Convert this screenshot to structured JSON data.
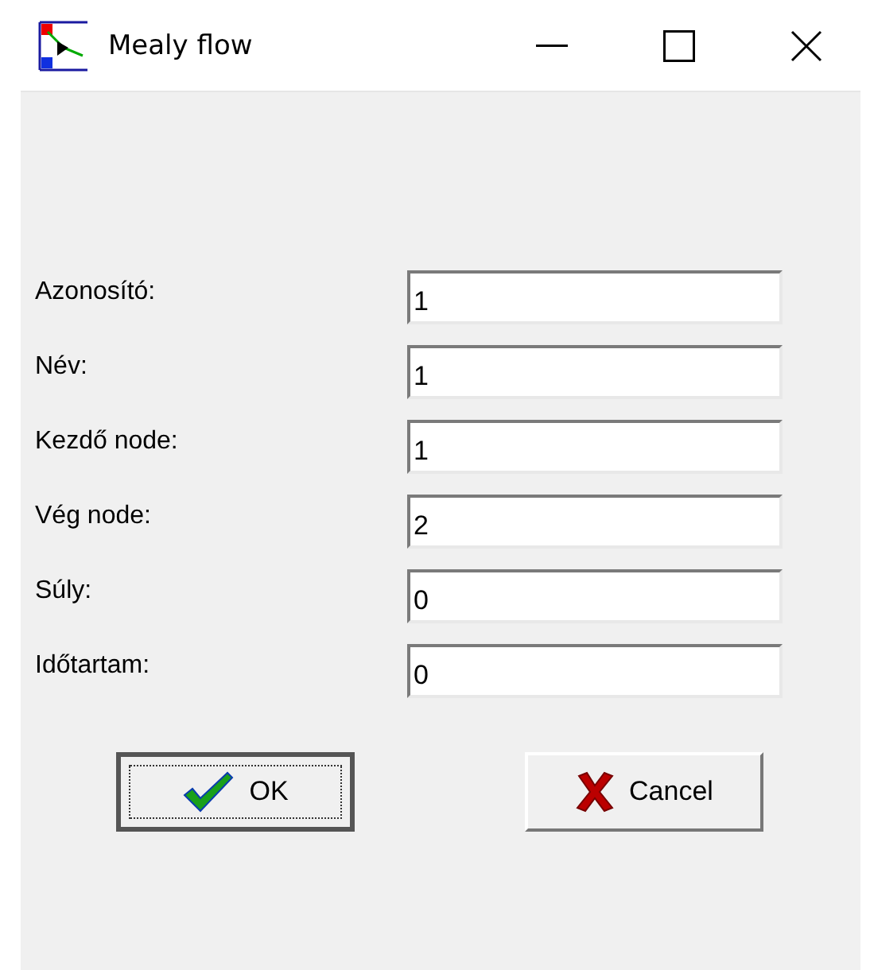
{
  "window": {
    "title": "Mealy flow"
  },
  "fields": [
    {
      "label": "Azonosító:",
      "value": "1"
    },
    {
      "label": "Név:",
      "value": "1"
    },
    {
      "label": "Kezdő node:",
      "value": "1"
    },
    {
      "label": "Vég node:",
      "value": "2"
    },
    {
      "label": "Súly:",
      "value": "0"
    },
    {
      "label": "Időtartam:",
      "value": "0"
    }
  ],
  "buttons": [
    {
      "kind": "ok",
      "label": "OK",
      "focused": true
    },
    {
      "kind": "cancel",
      "label": "Cancel",
      "focused": false
    }
  ]
}
